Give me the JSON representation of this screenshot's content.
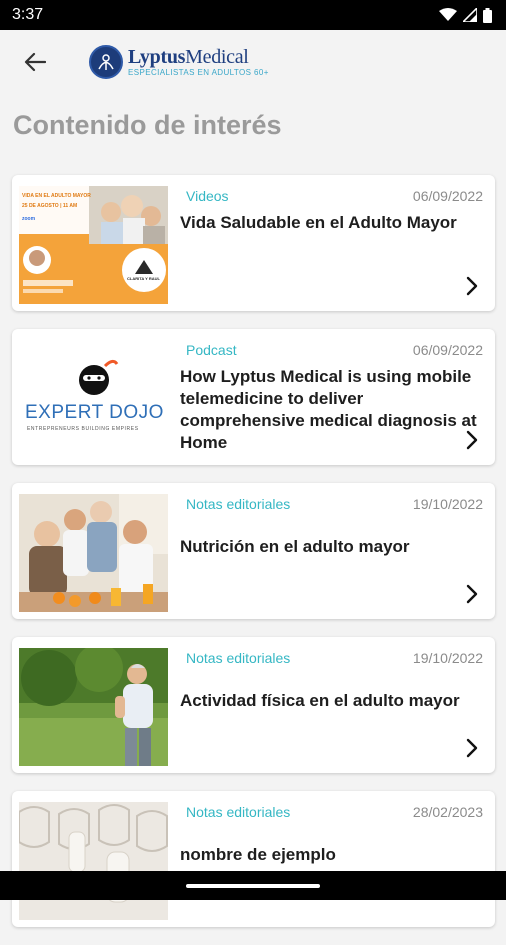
{
  "status_bar": {
    "time": "3:37"
  },
  "header": {
    "logo": {
      "name_bold": "Lyptus",
      "name_light": "Medical",
      "tagline": "ESPECIALISTAS EN ADULTOS 60+"
    }
  },
  "page": {
    "title": "Contenido de interés"
  },
  "items": [
    {
      "category": "Videos",
      "date": "06/09/2022",
      "title": "Vida Saludable en el Adulto Mayor",
      "thumb": {
        "line1": "VIDA EN EL ADULTO MAYOR",
        "line2": "25 DE AGOSTO | 11 AM",
        "badge": "zoom",
        "seal": "CLARITA Y RAUL"
      }
    },
    {
      "category": "Podcast",
      "date": "06/09/2022",
      "title": "How Lyptus Medical is using mobile telemedicine to deliver comprehensive medical diagnosis at Home",
      "thumb": {
        "brand": "EXPERT DOJO",
        "sub": "ENTREPRENEURS BUILDING EMPIRES"
      }
    },
    {
      "category": "Notas editoriales",
      "date": "19/10/2022",
      "title": "Nutrición en el adulto mayor"
    },
    {
      "category": "Notas editoriales",
      "date": "19/10/2022",
      "title": "Actividad física en el adulto mayor"
    },
    {
      "category": "Notas editoriales",
      "date": "28/02/2023",
      "title": "nombre de ejemplo"
    }
  ],
  "colors": {
    "accent": "#35b7c4",
    "brand": "#1f3f80",
    "title": "#9a9a9a"
  }
}
